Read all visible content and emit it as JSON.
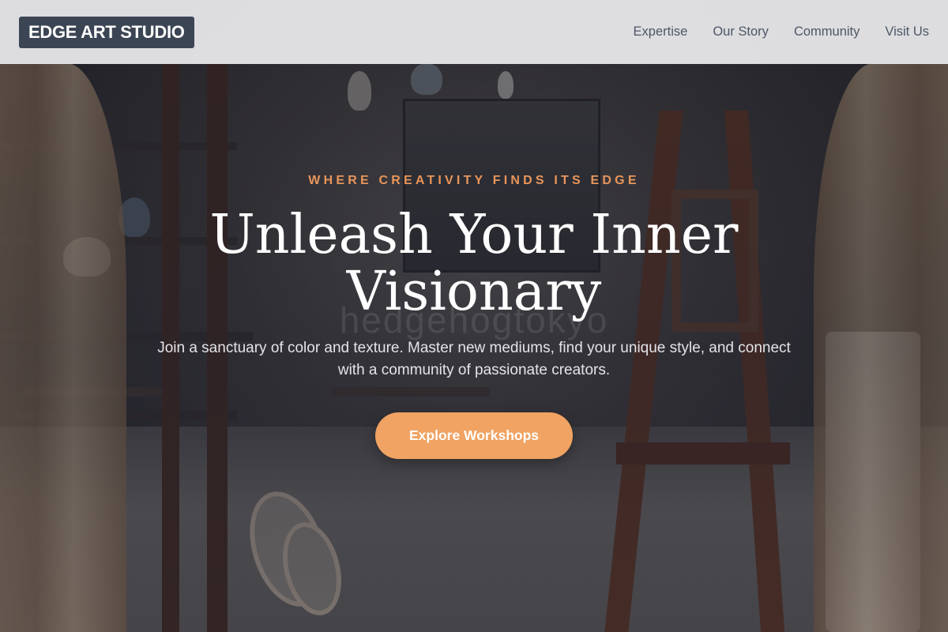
{
  "brand": {
    "name": "EDGE ART STUDIO"
  },
  "nav": {
    "links": [
      {
        "label": "Expertise"
      },
      {
        "label": "Our Story"
      },
      {
        "label": "Community"
      },
      {
        "label": "Visit Us"
      }
    ]
  },
  "hero": {
    "eyebrow": "WHERE CREATIVITY FINDS ITS EDGE",
    "headline_line1": "Unleash Your Inner",
    "headline_line2": "Visionary",
    "subtext": "Join a sanctuary of color and texture. Master new mediums, find your unique style, and connect with a community of passionate creators.",
    "cta_label": "Explore Workshops",
    "watermark": "hedgehogtokyo"
  },
  "colors": {
    "brand_bg": "#3c4554",
    "accent": "#f0a362",
    "eyebrow": "#e8955a",
    "nav_bg": "#ececee",
    "nav_text": "#4d5666"
  }
}
